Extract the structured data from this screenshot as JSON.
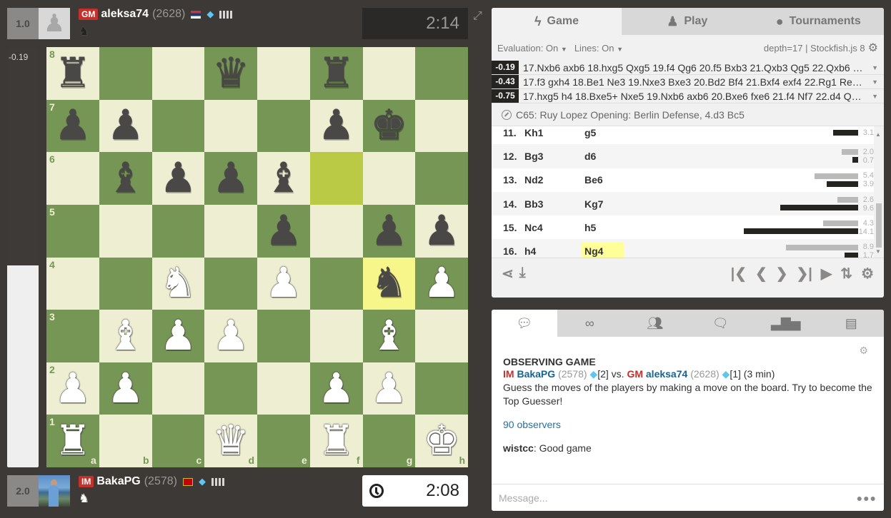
{
  "top_player": {
    "score": "1.0",
    "title": "GM",
    "name": "aleksa74",
    "rating": "(2628)",
    "flag": "serbia-flag",
    "piece_color": "black",
    "piece_glyph": "♞",
    "clock": "2:14"
  },
  "bottom_player": {
    "score": "2.0",
    "title": "IM",
    "name": "BakaPG",
    "rating": "(2578)",
    "flag": "montenegro-flag",
    "piece_color": "white",
    "piece_glyph": "♞",
    "clock": "2:08"
  },
  "evaluation": {
    "label": "-0.19",
    "white_share": 0.48
  },
  "board": {
    "ranks": [
      "8",
      "7",
      "6",
      "5",
      "4",
      "3",
      "2",
      "1"
    ],
    "files": [
      "a",
      "b",
      "c",
      "d",
      "e",
      "f",
      "g",
      "h"
    ],
    "position": [
      [
        "bR",
        "",
        "",
        "bQ",
        "",
        "bR",
        "",
        ""
      ],
      [
        "bP",
        "bP",
        "",
        "",
        "",
        "bP",
        "bK",
        ""
      ],
      [
        "",
        "bB",
        "bP",
        "bP",
        "bB",
        "",
        "",
        ""
      ],
      [
        "",
        "",
        "",
        "",
        "bP",
        "",
        "bP",
        "bP"
      ],
      [
        "",
        "",
        "wN",
        "",
        "wP",
        "",
        "bN",
        "wP"
      ],
      [
        "",
        "wB",
        "wP",
        "wP",
        "",
        "",
        "wB",
        ""
      ],
      [
        "wP",
        "wP",
        "",
        "",
        "",
        "wP",
        "wP",
        ""
      ],
      [
        "wR",
        "",
        "",
        "wQ",
        "",
        "wR",
        "",
        "wK"
      ]
    ],
    "last_move_from": "f6",
    "last_move_to": "g4",
    "colors": {
      "light": "#eeeed2",
      "dark": "#769656",
      "from": "#baca44",
      "to": "#f6f68a"
    }
  },
  "analysis": {
    "tabs": [
      {
        "label": "Game",
        "icon": "lightning-icon"
      },
      {
        "label": "Play",
        "icon": "pawn-hand-icon"
      },
      {
        "label": "Tournaments",
        "icon": "medal-icon"
      }
    ],
    "evaluation_toggle": "Evaluation: On",
    "lines_toggle": "Lines: On",
    "engine_info": "depth=17 | Stockfish.js 8",
    "lines": [
      {
        "eval": "-0.19",
        "moves": "17.Nxb6 axb6 18.hxg5 Qxg5 19.f4 Qg6 20.f5 Bxb3 21.Qxb3 Qg5 22.Qxb6 …"
      },
      {
        "eval": "-0.43",
        "moves": "17.f3 gxh4 18.Be1 Ne3 19.Nxe3 Bxe3 20.Bd2 Bf4 21.Bxf4 exf4 22.Rg1 Re…"
      },
      {
        "eval": "-0.75",
        "moves": "17.hxg5 h4 18.Bxe5+ Nxe5 19.Nxb6 axb6 20.Bxe6 fxe6 21.f4 Nf7 22.d4 Q…"
      }
    ],
    "opening": "C65: Ruy Lopez Opening: Berlin Defense, 4.d3 Bc5",
    "moves": [
      {
        "num": "11.",
        "white": "Kh1",
        "black": "g5",
        "white_time": null,
        "black_time": 3.1
      },
      {
        "num": "12.",
        "white": "Bg3",
        "black": "d6",
        "white_time": 2.0,
        "black_time": 0.7
      },
      {
        "num": "13.",
        "white": "Nd2",
        "black": "Be6",
        "white_time": 5.4,
        "black_time": 3.9
      },
      {
        "num": "14.",
        "white": "Bb3",
        "black": "Kg7",
        "white_time": 2.6,
        "black_time": 9.6
      },
      {
        "num": "15.",
        "white": "Nc4",
        "black": "h5",
        "white_time": 4.3,
        "black_time": 14.1
      },
      {
        "num": "16.",
        "white": "h4",
        "black": "Ng4",
        "white_time": 8.9,
        "black_time": 1.7
      }
    ],
    "current_move": "Ng4"
  },
  "chat": {
    "tabs": [
      "chat-icon",
      "binoculars-icon",
      "friends-icon",
      "messages-icon",
      "leaderboard-icon",
      "archive-icon"
    ],
    "heading": "OBSERVING GAME",
    "white": {
      "title": "IM",
      "name": "BakaPG",
      "rating": "(2578)",
      "gem_count": "[2]"
    },
    "vs": "vs.",
    "black": {
      "title": "GM",
      "name": "aleksa74",
      "rating": "(2628)",
      "gem_count": "[1]"
    },
    "time_control": "(3 min)",
    "description": "Guess the moves of the players by making a move on the board. Try to become the Top Guesser!",
    "observers": "90 observers",
    "message": {
      "user": "wistcc",
      "text": ": Good game"
    },
    "input_placeholder": "Message..."
  }
}
